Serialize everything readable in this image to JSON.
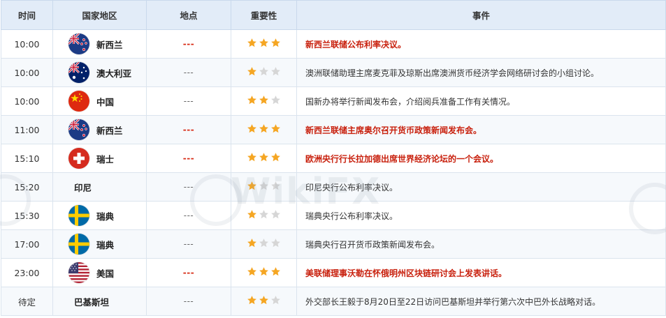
{
  "headers": [
    "时间",
    "国家地区",
    "地点",
    "重要性",
    "事件"
  ],
  "rows": [
    {
      "time": "10:00",
      "flag": "nz-flag-icon",
      "country": "新西兰",
      "place": "---",
      "stars": 3,
      "event": "新西兰联储公布利率决议。",
      "highlight": true
    },
    {
      "time": "10:00",
      "flag": "au-flag-icon",
      "country": "澳大利亚",
      "place": "---",
      "stars": 1,
      "event": "澳洲联储助理主席麦克菲及琼斯出席澳洲货币经济学会网络研讨会的小组讨论。",
      "highlight": false
    },
    {
      "time": "10:00",
      "flag": "cn-flag-icon",
      "country": "中国",
      "place": "---",
      "stars": 2,
      "event": "国新办将举行新闻发布会，介绍阅兵准备工作有关情况。",
      "highlight": false
    },
    {
      "time": "11:00",
      "flag": "nz-flag-icon",
      "country": "新西兰",
      "place": "---",
      "stars": 3,
      "event": "新西兰联储主席奥尔召开货币政策新闻发布会。",
      "highlight": true
    },
    {
      "time": "15:10",
      "flag": "ch-flag-icon",
      "country": "瑞士",
      "place": "---",
      "stars": 3,
      "event": "欧洲央行行长拉加德出席世界经济论坛的一个会议。",
      "highlight": true
    },
    {
      "time": "15:20",
      "flag": "",
      "country": "印尼",
      "place": "---",
      "stars": 1,
      "event": "印尼央行公布利率决议。",
      "highlight": false
    },
    {
      "time": "15:30",
      "flag": "se-flag-icon",
      "country": "瑞典",
      "place": "---",
      "stars": 1,
      "event": "瑞典央行公布利率决议。",
      "highlight": false
    },
    {
      "time": "17:00",
      "flag": "se-flag-icon",
      "country": "瑞典",
      "place": "---",
      "stars": 1,
      "event": "瑞典央行召开货币政策新闻发布会。",
      "highlight": false
    },
    {
      "time": "23:00",
      "flag": "us-flag-icon",
      "country": "美国",
      "place": "---",
      "stars": 3,
      "event": "美联储理事沃勒在怀俄明州区块链研讨会上发表讲话。",
      "highlight": true
    },
    {
      "time": "待定",
      "flag": "",
      "country": "巴基斯坦",
      "place": "---",
      "stars": 2,
      "event": "外交部长王毅于8月20日至22日访问巴基斯坦并举行第六次中巴外长战略对话。",
      "highlight": false
    }
  ],
  "watermark": "WikiFX",
  "colors": {
    "header_bg": "#e2ecf8",
    "highlight_text": "#c8200d",
    "star_on": "#f5a623",
    "star_off": "#d6d6d6"
  }
}
